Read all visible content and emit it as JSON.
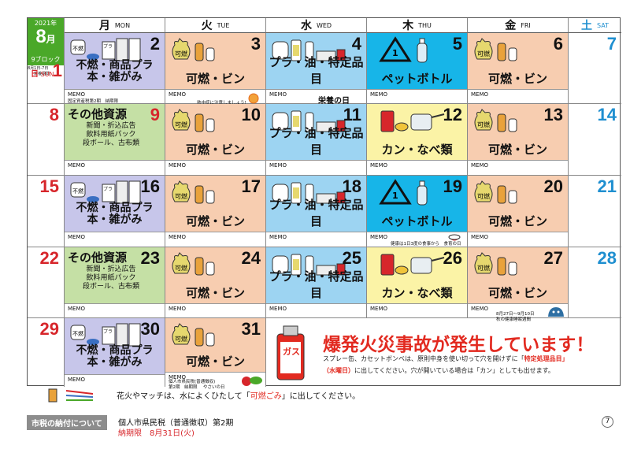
{
  "corner": {
    "year": "2021年",
    "month": "8",
    "month_suffix": "月",
    "block": "9ブロック"
  },
  "weekdays": [
    {
      "jp": "月",
      "en": "MON"
    },
    {
      "jp": "火",
      "en": "TUE"
    },
    {
      "jp": "水",
      "en": "WED"
    },
    {
      "jp": "木",
      "en": "THU"
    },
    {
      "jp": "金",
      "en": "FRI"
    },
    {
      "jp": "土",
      "en": "SAT"
    }
  ],
  "sunday_label": {
    "num": "日",
    "en": "SUN"
  },
  "waste": {
    "plastic": [
      "不燃・商品プラ",
      "本・雑がみ"
    ],
    "burnable": "可燃・ビン",
    "special": "プラ・油・特定品目",
    "pet": "ペットボトル",
    "cans": "カン・なべ類",
    "other_title": "その他資源",
    "other_lines": [
      "新聞・折込広告",
      "飲料用紙パック",
      "段ボール、古布類"
    ]
  },
  "icon_labels": {
    "unburnable": "不燃",
    "plastic_mark": "プラ",
    "burnable": "可燃",
    "gas": "ガス"
  },
  "memo": "MEMO",
  "days": {
    "d1": "1",
    "d2": "2",
    "d3": "3",
    "d4": "4",
    "d5": "5",
    "d6": "6",
    "d7": "7",
    "d8": "8",
    "d9": "9",
    "d10": "10",
    "d11": "11",
    "d12": "12",
    "d13": "13",
    "d14": "14",
    "d15": "15",
    "d16": "16",
    "d17": "17",
    "d18": "18",
    "d19": "19",
    "d20": "20",
    "d21": "21",
    "d22": "22",
    "d23": "23",
    "d24": "24",
    "d25": "25",
    "d26": "26",
    "d27": "27",
    "d28": "28",
    "d29": "29",
    "d30": "30",
    "d31": "31"
  },
  "notes": {
    "sun1": [
      "8月1日-7日",
      "栄養週間"
    ],
    "mon2": "固定資産税第2期　納期限",
    "tue3": "熱中症に注意しましょう!",
    "wed4_logo": "栄養の日",
    "wed4_sub": "六月は栄養を大切に、みんなで",
    "thu19": "健康は1日3度の食事から　食育の日",
    "fri27": [
      "8月27日～9月10日",
      "秋の健康睡眠週間"
    ],
    "tue31": [
      "個人市県民税(普通徴収)",
      "第2期　納期限",
      "やさいの日"
    ]
  },
  "warning": {
    "title": "爆発火災事故が発生しています！",
    "body_1": "スプレー缶、カセットボンベは、原則中身を使い切って穴を開けずに「",
    "body_red1": "特定処理品目",
    "body_2": "（水曜日）",
    "body_3": "に出してください。穴が開いている場合は「カン」としても出せます。"
  },
  "footer": {
    "fire_note_1": "花火やマッチは、水によくひたして「",
    "fire_note_red": "可燃ごみ",
    "fire_note_2": "」に出してください。",
    "tax_label": "市税の納付について",
    "tax_line1": "個人市県民税（普通徴収）第2期",
    "tax_line2": "納期限　8月31日(火)",
    "page": "7"
  },
  "colors": {
    "corner": "#4aa829",
    "plastic": "#c7c6ea",
    "burnable": "#f7cdb0",
    "special": "#9dd4f2",
    "pet": "#17b5e8",
    "cans": "#fbf3a6",
    "other": "#c5e0a5",
    "sunday": "#d7262b",
    "saturday": "#1f8fd0",
    "warning": "#e22a20"
  }
}
